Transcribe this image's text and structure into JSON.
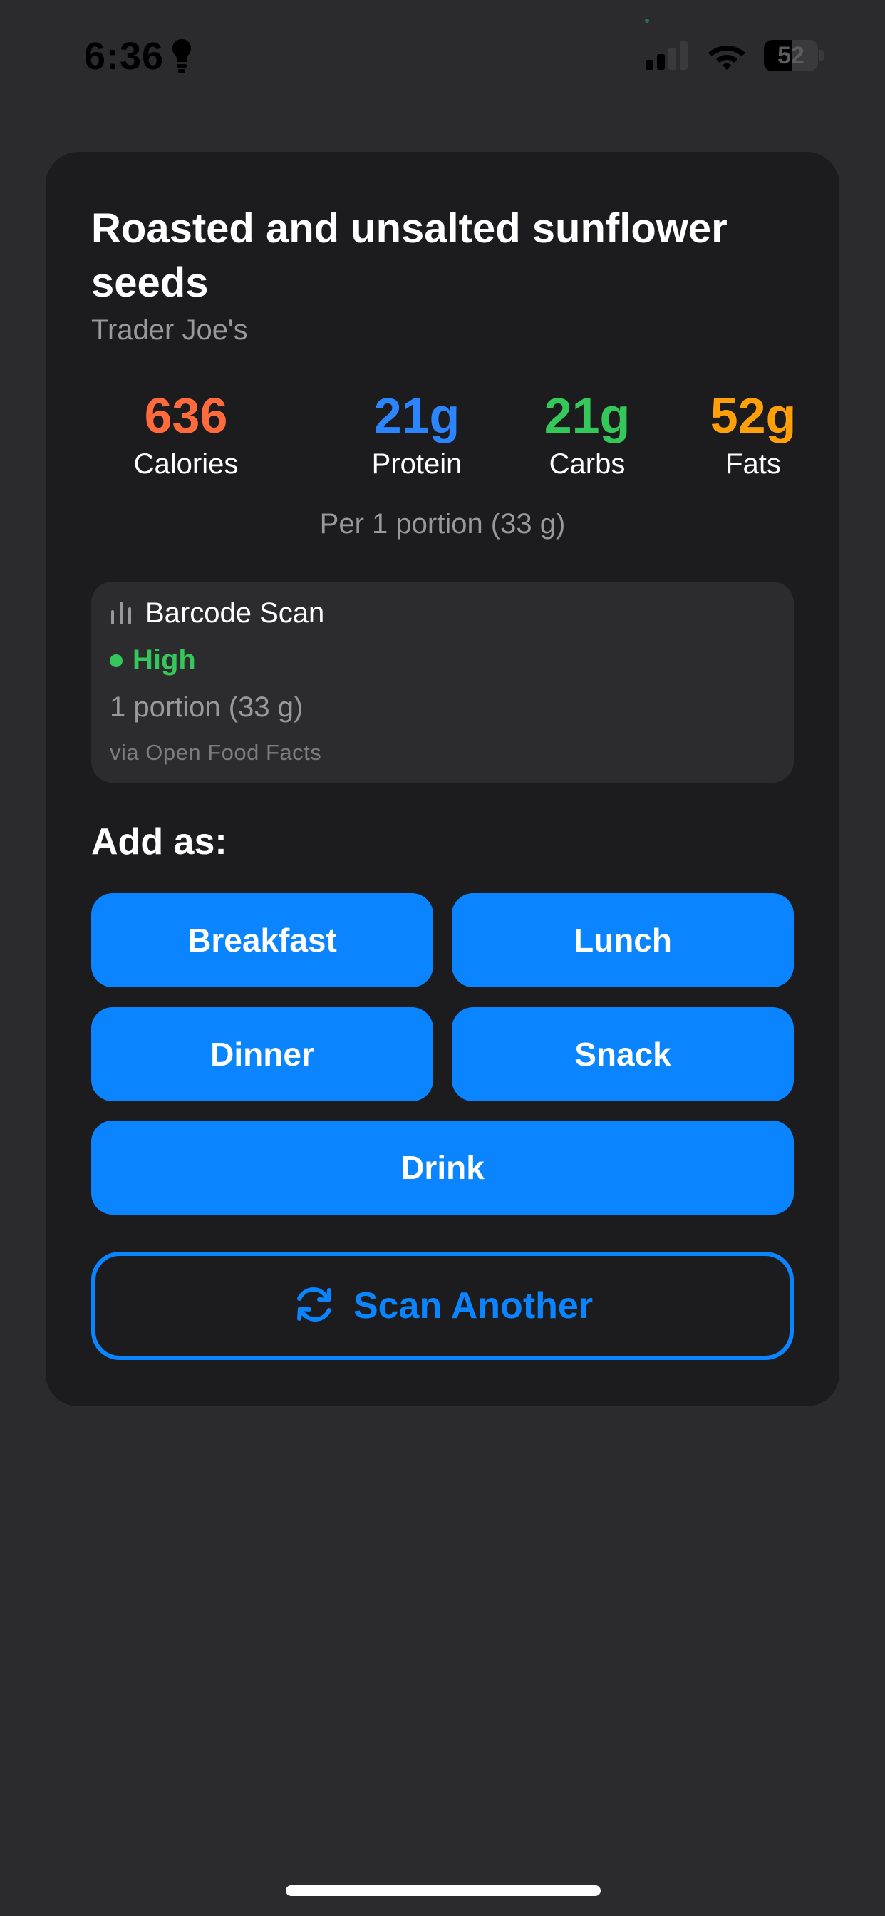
{
  "status_bar": {
    "time": "6:36",
    "battery_level": "52",
    "battery_fraction": 0.52
  },
  "food": {
    "title": "Roasted and unsalted sunflower seeds",
    "brand": "Trader Joe's"
  },
  "macros": [
    {
      "value": "636",
      "label": "Calories",
      "color": "#ff6b3d"
    },
    {
      "value": "21g",
      "label": "Protein",
      "color": "#2a85ff"
    },
    {
      "value": "21g",
      "label": "Carbs",
      "color": "#34c759"
    },
    {
      "value": "52g",
      "label": "Fats",
      "color": "#ff9f0a"
    }
  ],
  "per_portion": "Per 1 portion (33 g)",
  "scan_info": {
    "method": "Barcode Scan",
    "confidence": "High",
    "portion": "1 portion (33 g)",
    "source": "via Open Food Facts",
    "icon": "chart-bars-icon"
  },
  "add_as": {
    "heading": "Add as:",
    "options": [
      "Breakfast",
      "Lunch",
      "Dinner",
      "Snack",
      "Drink"
    ]
  },
  "scan_another": {
    "label": "Scan Another",
    "icon": "refresh-icon"
  },
  "colors": {
    "accent": "#0a84ff",
    "confidence_high": "#34c759",
    "card_background": "#1c1c1e",
    "page_background": "#2b2b2e"
  }
}
